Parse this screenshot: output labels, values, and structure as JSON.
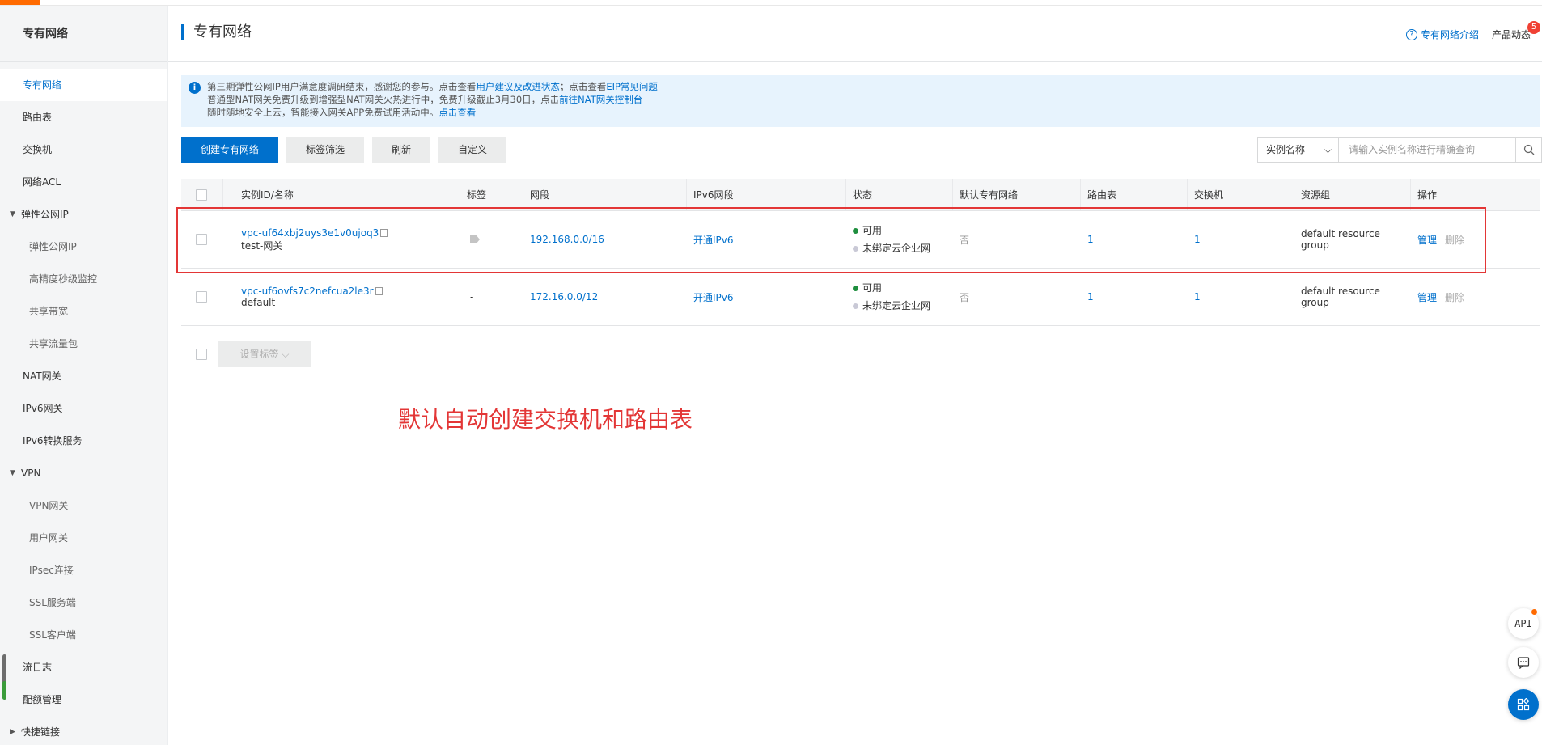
{
  "sidebar": {
    "title": "专有网络",
    "items": [
      {
        "label": "专有网络",
        "level": 1,
        "active": true
      },
      {
        "label": "路由表",
        "level": 1
      },
      {
        "label": "交换机",
        "level": 1
      },
      {
        "label": "网络ACL",
        "level": 1
      },
      {
        "label": "弹性公网IP",
        "level": 0,
        "caret": "▼"
      },
      {
        "label": "弹性公网IP",
        "level": 2
      },
      {
        "label": "高精度秒级监控",
        "level": 2
      },
      {
        "label": "共享带宽",
        "level": 2
      },
      {
        "label": "共享流量包",
        "level": 2
      },
      {
        "label": "NAT网关",
        "level": 1
      },
      {
        "label": "IPv6网关",
        "level": 1
      },
      {
        "label": "IPv6转换服务",
        "level": 1
      },
      {
        "label": "VPN",
        "level": 0,
        "caret": "▼"
      },
      {
        "label": "VPN网关",
        "level": 2
      },
      {
        "label": "用户网关",
        "level": 2
      },
      {
        "label": "IPsec连接",
        "level": 2
      },
      {
        "label": "SSL服务端",
        "level": 2
      },
      {
        "label": "SSL客户端",
        "level": 2
      },
      {
        "label": "流日志",
        "level": 1
      },
      {
        "label": "配额管理",
        "level": 1
      },
      {
        "label": "快捷链接",
        "level": 0,
        "caret": "▶"
      }
    ]
  },
  "header": {
    "title": "专有网络",
    "intro_link": "专有网络介绍",
    "news_label": "产品动态",
    "news_badge": "5"
  },
  "notice": {
    "line1_text": "第三期弹性公网IP用户满意度调研结束，感谢您的参与。点击查看",
    "line1_link1": "用户建议及改进状态",
    "line1_mid": "；点击查看",
    "line1_link2": "EIP常见问题",
    "line2_text": "普通型NAT网关免费升级到增强型NAT网关火热进行中，免费升级截止3月30日，点击",
    "line2_link": "前往NAT网关控制台",
    "line3_text": "随时随地安全上云，智能接入网关APP免费试用活动中。",
    "line3_link": "点击查看"
  },
  "toolbar": {
    "create": "创建专有网络",
    "tag_filter": "标签筛选",
    "refresh": "刷新",
    "customize": "自定义"
  },
  "search": {
    "field": "实例名称",
    "placeholder": "请输入实例名称进行精确查询"
  },
  "table": {
    "headers": [
      "实例ID/名称",
      "标签",
      "网段",
      "IPv6网段",
      "状态",
      "默认专有网络",
      "路由表",
      "交换机",
      "资源组",
      "操作"
    ],
    "rows": [
      {
        "id": "vpc-uf64xbj2uys3e1v0ujoq3",
        "name": "test-网关",
        "tag": "",
        "cidr": "192.168.0.0/16",
        "ipv6": "开通IPv6",
        "status": "可用",
        "cen": "未绑定云企业网",
        "default": "否",
        "route_tables": "1",
        "vswitches": "1",
        "resource_group": "default resource group",
        "op_manage": "管理",
        "op_delete": "删除"
      },
      {
        "id": "vpc-uf6ovfs7c2nefcua2le3r",
        "name": "default",
        "tag": "-",
        "cidr": "172.16.0.0/12",
        "ipv6": "开通IPv6",
        "status": "可用",
        "cen": "未绑定云企业网",
        "default": "否",
        "route_tables": "1",
        "vswitches": "1",
        "resource_group": "default resource group",
        "op_manage": "管理",
        "op_delete": "删除"
      }
    ]
  },
  "batch": {
    "set_tags": "设置标签"
  },
  "annotation": {
    "note": "默认自动创建交换机和路由表",
    "color": "#e33636"
  },
  "float_buttons": {
    "api": "API"
  },
  "colors": {
    "accent": "#0070cc",
    "brand": "#ff6a00",
    "status_ok": "#1e8e3e"
  }
}
